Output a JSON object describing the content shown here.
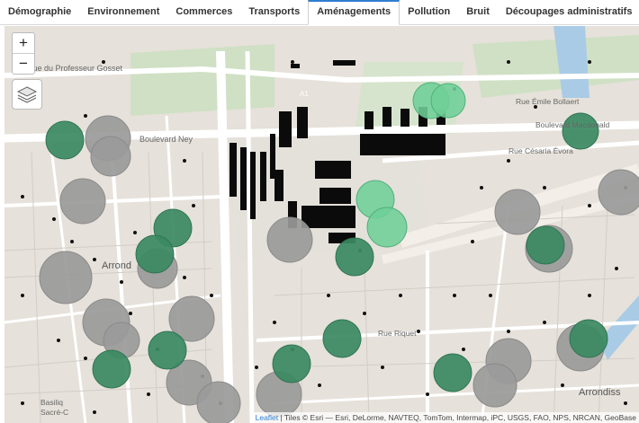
{
  "tabs": [
    {
      "label": "Démographie"
    },
    {
      "label": "Environnement"
    },
    {
      "label": "Commerces"
    },
    {
      "label": "Transports"
    },
    {
      "label": "Aménagements",
      "active": true
    },
    {
      "label": "Pollution"
    },
    {
      "label": "Bruit"
    },
    {
      "label": "Découpages administratifs"
    }
  ],
  "map": {
    "zoom_in_label": "+",
    "zoom_out_label": "−",
    "layers_icon": "layers-icon",
    "attribution_link": "Leaflet",
    "attribution_text": " | Tiles © Esri — Esri, DeLorme, NAVTEQ, TomTom, Intermap, iPC, USGS, FAO, NPS, NRCAN, GeoBase",
    "labels": {
      "rue_gosset": "Rue du Professeur Gosset",
      "a1": "A1",
      "bd_ney": "Boulevard Ney",
      "rue_bollaert": "Rue Émile Bollaert",
      "bd_macdonald": "Boulevard Macdonald",
      "rue_evora": "Rue Césaria Évora",
      "arrond_left": "Arrond",
      "arrond_right": "Arrondiss",
      "rue_riquet": "Rue Riquet",
      "basilique": "Basiliq",
      "sacre": "Sacré-C"
    },
    "colors": {
      "gray_circle": "#9e9e9e",
      "green_dark": "#3b8a62",
      "green_light": "#6fcf97",
      "building": "#0b0b0b",
      "park": "#c6dcb9",
      "road": "#ffffff"
    }
  }
}
